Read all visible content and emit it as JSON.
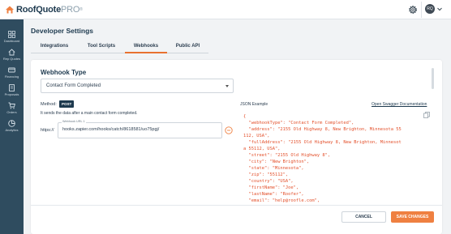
{
  "header": {
    "logo_name": "RoofQuote",
    "logo_suffix": "PRO",
    "logo_tm": "®",
    "gear_icon": "gear-icon",
    "avatar_initials": "RQ",
    "chevron_icon": "chevron-down-icon"
  },
  "sidebar": {
    "items": [
      {
        "label": "Dashboard",
        "icon": "dashboard-icon"
      },
      {
        "label": "Rep Quotes",
        "icon": "rep-quotes-icon"
      },
      {
        "label": "Financing",
        "icon": "financing-icon"
      },
      {
        "label": "Proposals",
        "icon": "proposals-icon"
      },
      {
        "label": "Orders",
        "icon": "cart-icon"
      },
      {
        "label": "Analytics",
        "icon": "analytics-icon"
      }
    ]
  },
  "page": {
    "title": "Developer Settings",
    "tabs": [
      {
        "label": "Integrations",
        "active": false
      },
      {
        "label": "Tool Scripts",
        "active": false
      },
      {
        "label": "Webhooks",
        "active": true
      },
      {
        "label": "Public API",
        "active": false
      }
    ]
  },
  "webhook": {
    "section_title": "Webhook Type",
    "selected_type": "Contact Form Completed",
    "method_label": "Method:",
    "method": "POST",
    "description": "It sends the data after a main contact form completed.",
    "protocol": "https://",
    "url_label": "Webhook URL 1",
    "url_value": "hooks.zapier.com/hooks/catch/8618581/uo75pgj/"
  },
  "json_sample": {
    "title": "JSON Example",
    "swagger_link": "Open Swagger Documentation",
    "lines": [
      "{",
      "  \"webhookType\": \"Contact Form Completed\",",
      "  \"address\": \"2155 Old Highway 8, New Brighton, Minnesota 55",
      "112, USA\",",
      "  \"fullAddress\": \"2155 Old Highway 8, New Brighton, Minnesot",
      "a 55112, USA\",",
      "  \"street\": \"2155 Old Highway 8\",",
      "  \"city\": \"New Brighton\",",
      "  \"state\": \"Minnesota\",",
      "  \"zip\": \"55112\",",
      "  \"country\": \"USA\",",
      "  \"firstName\": \"Joe\",",
      "  \"lastName\": \"Roofer\",",
      "  \"email\": \"help@roofle.com\","
    ]
  },
  "footer": {
    "cancel_label": "CANCEL",
    "save_label": "SAVE CHANGES"
  },
  "colors": {
    "sidebar": "#2f4c5f",
    "accent": "#ef8041",
    "json_text": "#e3502b",
    "brand_dark": "#1e3a4f"
  }
}
